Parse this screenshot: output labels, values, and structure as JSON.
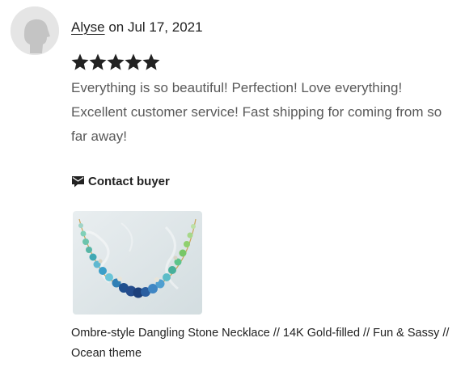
{
  "review": {
    "author": "Alyse",
    "date_text": "on Jul 17, 2021",
    "rating": 5,
    "rating_max": 5,
    "text": "Everything is so beautiful! Perfection! Love everything! Excellent customer service! Fast shipping for coming from so far away!"
  },
  "contact": {
    "label": "Contact buyer",
    "icon": "message-icon"
  },
  "product": {
    "title": "Ombre-style Dangling Stone Necklace // 14K Gold-filled // Fun & Sassy // Ocean theme",
    "image_icon": "necklace-image"
  },
  "colors": {
    "text": "#222222",
    "muted_text": "#595959",
    "star": "#222222",
    "avatar_bg": "#e5e5e5",
    "avatar_fg": "#c4c4c4"
  }
}
